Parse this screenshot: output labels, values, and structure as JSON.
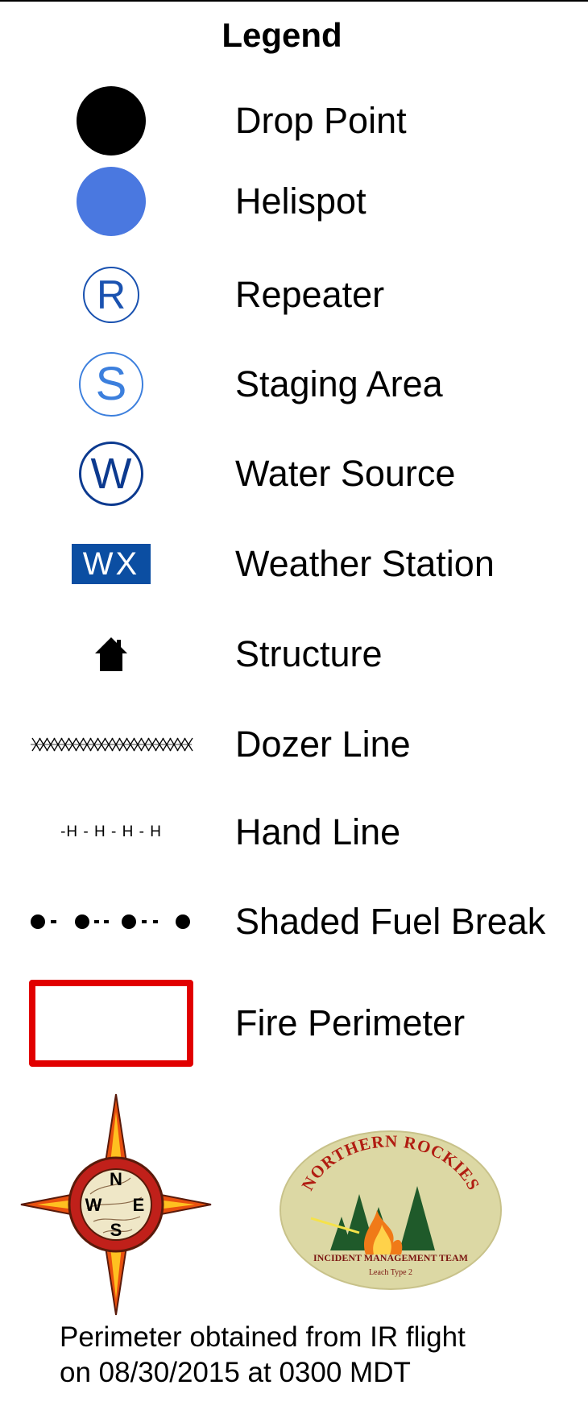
{
  "legend": {
    "title": "Legend",
    "items": [
      {
        "symbol": "drop-point-icon",
        "label": "Drop Point"
      },
      {
        "symbol": "helispot-icon",
        "label": "Helispot"
      },
      {
        "symbol": "repeater-icon",
        "letter": "R",
        "label": "Repeater"
      },
      {
        "symbol": "staging-area-icon",
        "letter": "S",
        "label": "Staging Area"
      },
      {
        "symbol": "water-source-icon",
        "letter": "W",
        "label": "Water Source"
      },
      {
        "symbol": "weather-station-icon",
        "letter": "WX",
        "label": "Weather Station"
      },
      {
        "symbol": "house-icon",
        "label": "Structure"
      },
      {
        "symbol": "dozer-line-icon",
        "label": "Dozer Line"
      },
      {
        "symbol": "hand-line-icon",
        "pattern": "-H - H - H - H",
        "label": "Hand Line"
      },
      {
        "symbol": "shaded-fuel-break-icon",
        "label": "Shaded Fuel Break"
      },
      {
        "symbol": "fire-perimeter-icon",
        "label": "Fire Perimeter"
      }
    ],
    "colors": {
      "drop_point": "#000000",
      "helispot": "#4a78e0",
      "repeater": "#1a52b0",
      "staging_area": "#3c7fdd",
      "water_source": "#0c3a8f",
      "weather_station_bg": "#0b4ea2",
      "fire_perimeter": "#e10000"
    }
  },
  "compass": {
    "letters": {
      "north": "N",
      "east": "E",
      "south": "S",
      "west": "W"
    }
  },
  "team_logo": {
    "arc_text": "NORTHERN ROCKIES",
    "line1": "INCIDENT MANAGEMENT TEAM",
    "line2": "Leach Type 2"
  },
  "footer": {
    "line1": "Perimeter obtained from IR flight",
    "line2": "on 08/30/2015 at 0300 MDT"
  }
}
